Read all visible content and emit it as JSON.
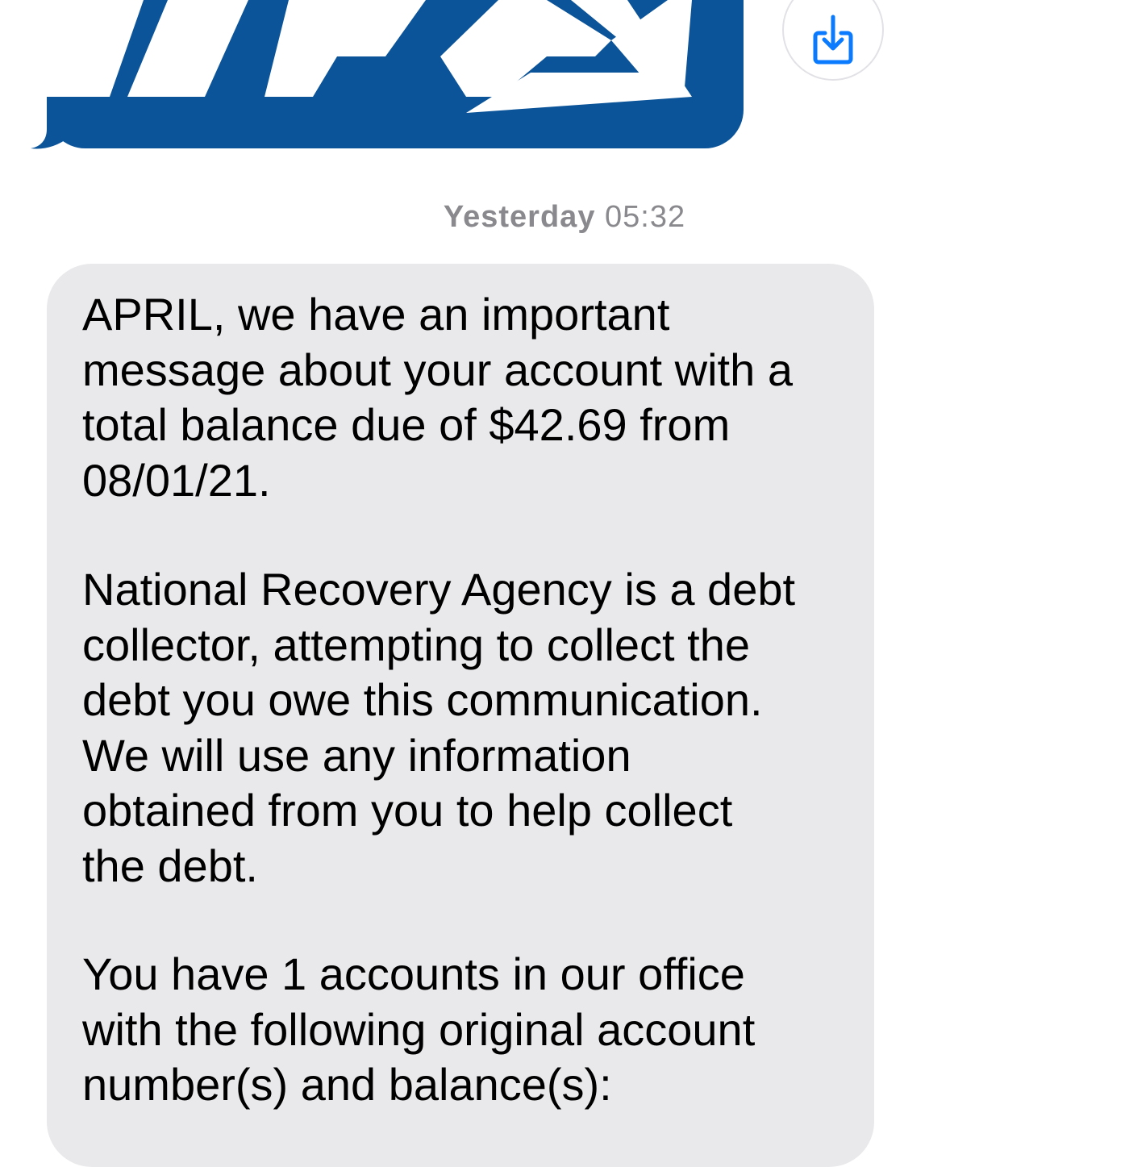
{
  "conversation": {
    "image_message": {
      "logo_alt": "NRA",
      "logo_icon": "nra-logo",
      "colors": {
        "brand": "#0b5499",
        "logo_fill": "#ffffff"
      }
    },
    "save_button": {
      "icon": "download-icon",
      "color": "#0a7aff"
    },
    "timestamp": {
      "day": "Yesterday",
      "time": "05:32"
    },
    "text_message": {
      "paragraphs": [
        "APRIL, we have an important\nmessage about your account with a\ntotal balance due of $42.69 from\n08/01/21.",
        "National Recovery Agency is a debt\ncollector, attempting to collect the\ndebt you owe this communication.\nWe will use any information\nobtained from you to help collect\nthe debt.",
        "You have 1 accounts in our office\nwith the following original account\nnumber(s) and balance(s):"
      ],
      "colors": {
        "bubble": "#e9e9eb",
        "text": "#000000"
      }
    }
  }
}
